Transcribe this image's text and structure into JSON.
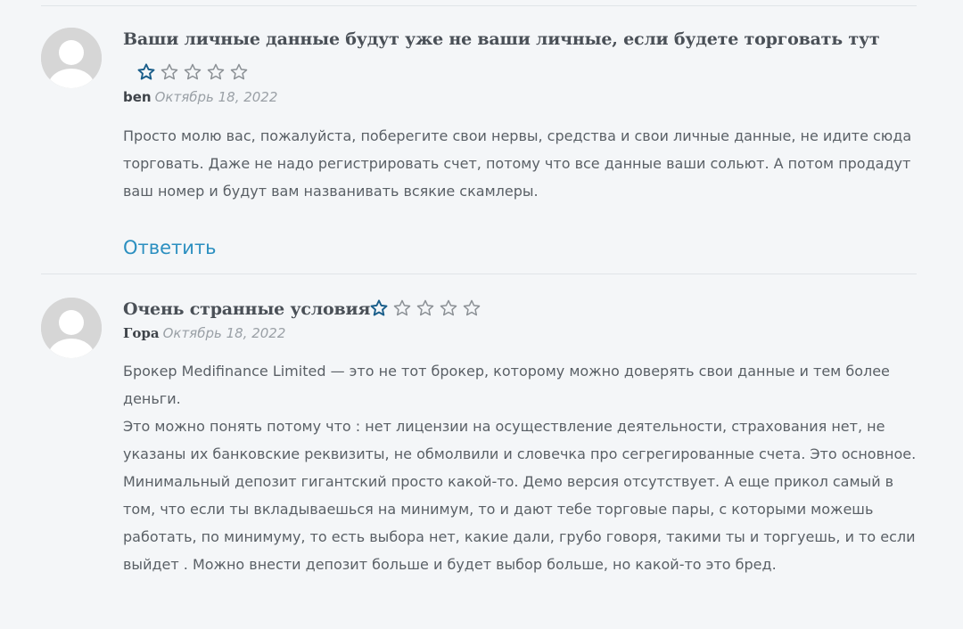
{
  "comments": [
    {
      "title": "Ваши личные данные будут уже не ваши личные, если будете торговать тут",
      "rating": 1,
      "rating_max": 5,
      "author": "ben",
      "date": "Октябрь 18, 2022",
      "paragraphs": [
        "Просто молю вас, пожалуйста, поберегите свои нервы, средства и свои личные данные, не идите сюда торговать. Даже не надо регистрировать счет, потому что все данные ваши сольют. А потом продадут ваш номер и будут вам названивать всякие скамлеры."
      ],
      "reply_label": "Ответить"
    },
    {
      "title": "Очень странные условия",
      "rating": 1,
      "rating_max": 5,
      "author": "Гора",
      "date": "Октябрь 18, 2022",
      "paragraphs": [
        "Брокер Medifinance Limited — это не тот брокер, которому можно доверять свои данные и тем более деньги.",
        "Это можно понять потому что : нет лицензии на осуществление деятельности, страхования нет, не указаны их банковские реквизиты, не обмолвили и словечка про сегрегированные счета. Это основное.",
        "Минимальный депозит гигантский просто какой-то. Демо версия отсутствует. А еще прикол самый в том, что если ты вкладываешься на минимум, то и дают тебе торговые пары, с которыми можешь работать, по минимуму, то есть выбора нет, какие дали, грубо говоря, такими ты и торгуешь, и то если выйдет . Можно внести депозит больше и будет выбор больше, но какой-то это бред."
      ]
    }
  ],
  "colors": {
    "background": "#f4f6f8",
    "star_filled": "#1a5e8a",
    "star_empty": "#8a8f94",
    "link": "#2b8fc0"
  },
  "icons": {
    "avatar": "default-user-avatar-icon",
    "star_filled": "star-icon-filled",
    "star_empty": "star-icon-empty"
  }
}
